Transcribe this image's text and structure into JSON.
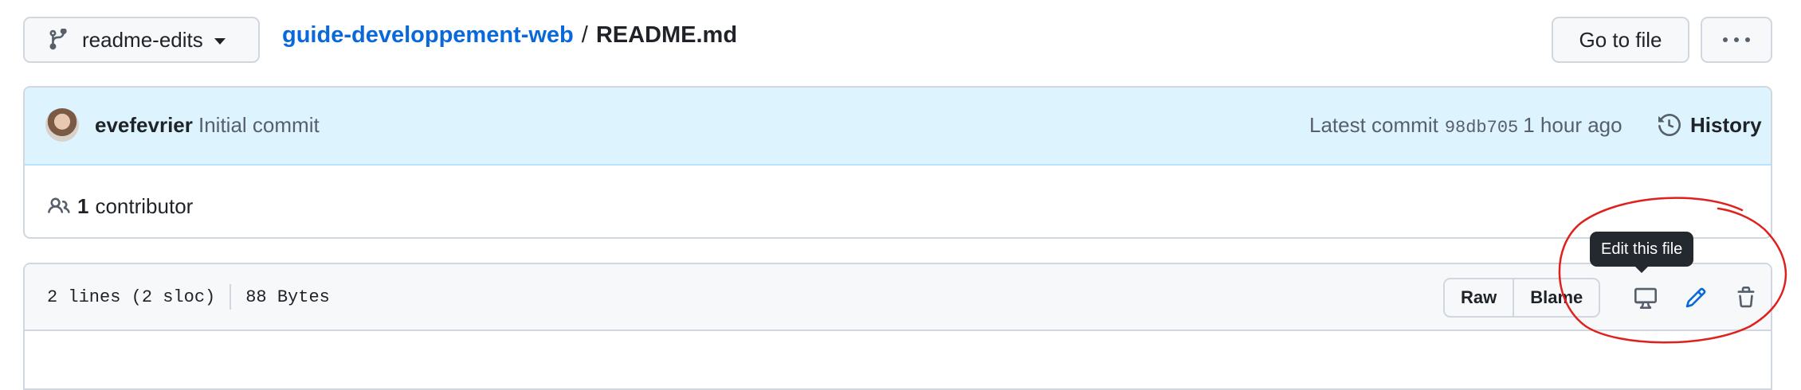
{
  "topbar": {
    "branch": {
      "label": "readme-edits"
    },
    "breadcrumb": {
      "repo": "guide-developpement-web",
      "separator": "/",
      "file": "README.md"
    },
    "goto_file": "Go to file"
  },
  "commit": {
    "author": "evefevrier",
    "message": "Initial commit",
    "latest_label": "Latest commit",
    "sha": "98db705",
    "time": "1 hour ago",
    "history_label": "History"
  },
  "contributors": {
    "count": "1",
    "label": "contributor"
  },
  "file": {
    "lines": "2 lines (2 sloc)",
    "size": "88 Bytes",
    "buttons": {
      "raw": "Raw",
      "blame": "Blame"
    },
    "tooltip": "Edit this file"
  },
  "colors": {
    "link": "#0969da",
    "commit_header_bg": "#ddf4ff",
    "tooltip_bg": "#24292f",
    "annotation": "#e0201c"
  },
  "icons": [
    "git-branch-icon",
    "caret-down-icon",
    "kebab-horizontal-icon",
    "history-icon",
    "people-icon",
    "desktop-icon",
    "pencil-icon",
    "trash-icon"
  ]
}
